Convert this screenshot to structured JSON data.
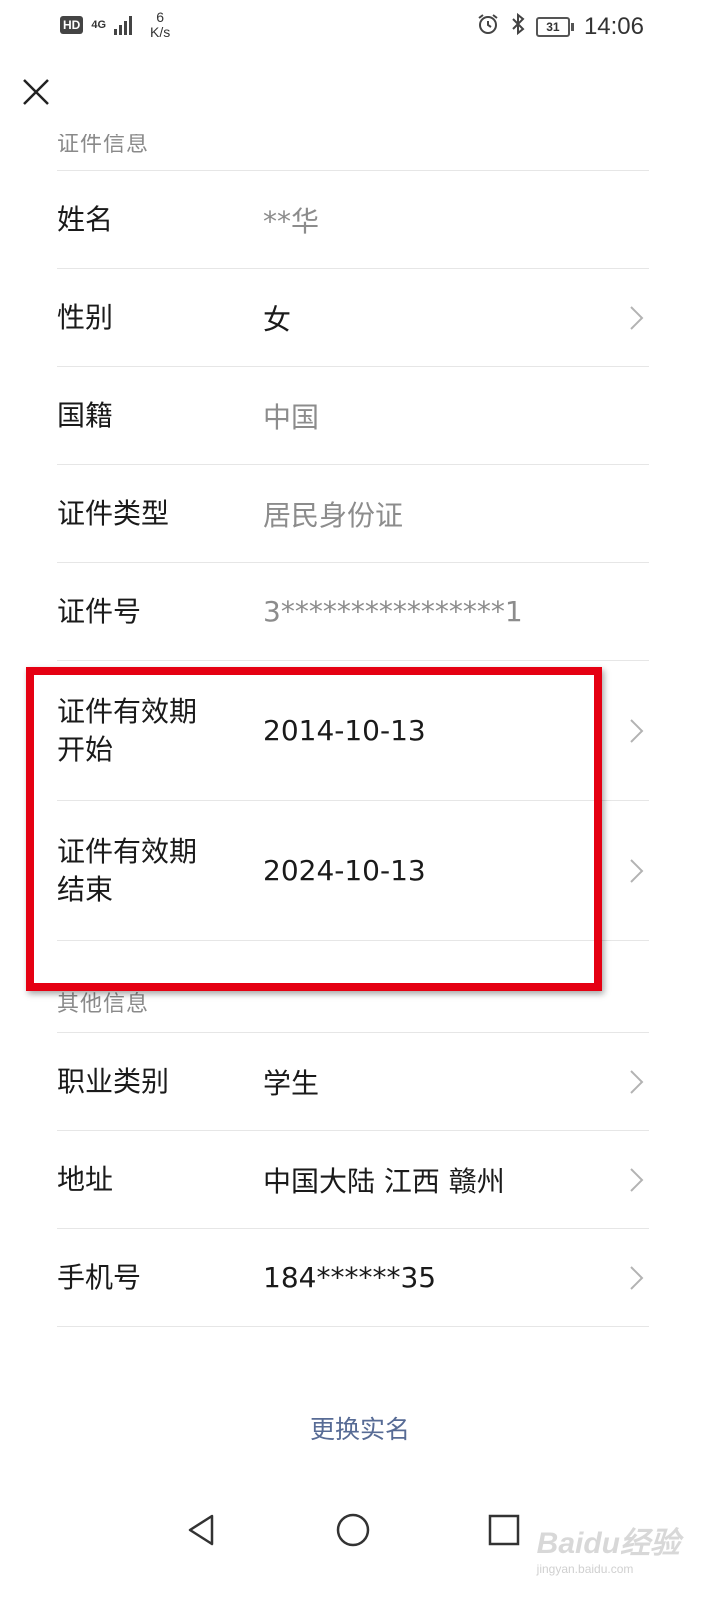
{
  "status_bar": {
    "hd": "HD",
    "network": "4G",
    "speed_value": "6",
    "speed_unit": "K/s",
    "battery": "31",
    "time": "14:06"
  },
  "sections": {
    "id_info": "证件信息",
    "other_info": "其他信息"
  },
  "fields": {
    "name": {
      "label": "姓名",
      "value": "**华"
    },
    "gender": {
      "label": "性别",
      "value": "女"
    },
    "nationality": {
      "label": "国籍",
      "value": "中国"
    },
    "id_type": {
      "label": "证件类型",
      "value": "居民身份证"
    },
    "id_number": {
      "label": "证件号",
      "value": "3****************1"
    },
    "valid_start": {
      "label_line1": "证件有效期",
      "label_line2": "开始",
      "value": "2014-10-13"
    },
    "valid_end": {
      "label_line1": "证件有效期",
      "label_line2": "结束",
      "value": "2024-10-13"
    },
    "occupation": {
      "label": "职业类别",
      "value": "学生"
    },
    "address": {
      "label": "地址",
      "value": "中国大陆 江西 赣州"
    },
    "phone": {
      "label": "手机号",
      "value": "184******35"
    }
  },
  "actions": {
    "change_realname": "更换实名"
  },
  "watermark": {
    "brand": "Baidu经验",
    "url": "jingyan.baidu.com"
  },
  "colors": {
    "highlight": "#e50012",
    "link": "#576b95",
    "muted": "#8c8c8c"
  }
}
